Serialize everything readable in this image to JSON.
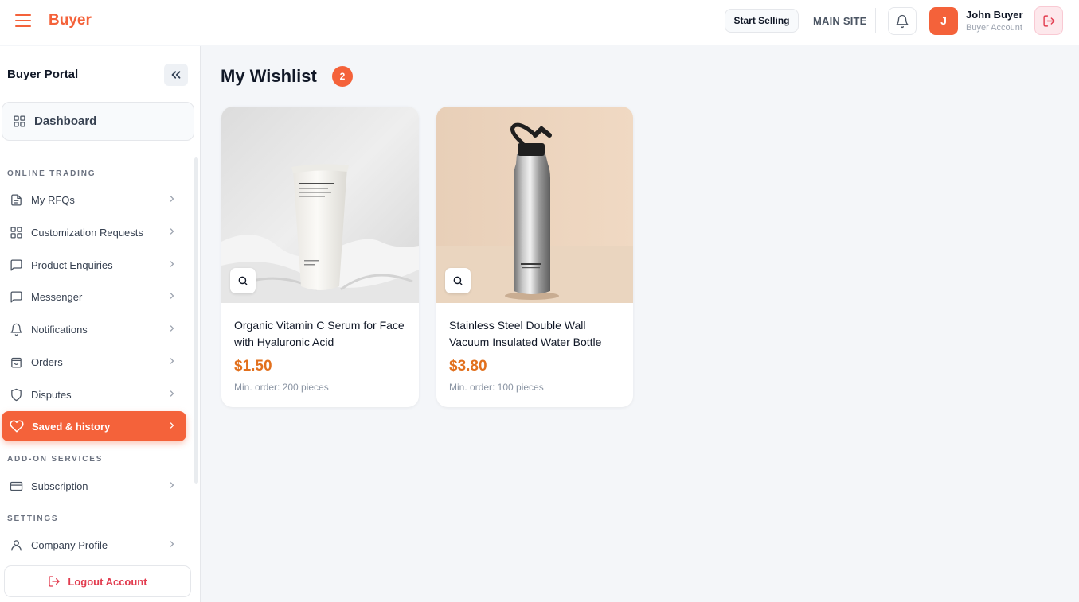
{
  "header": {
    "brand": "Buyer",
    "start_selling": "Start Selling",
    "main_site": "MAIN SITE",
    "user": {
      "initial": "J",
      "name": "John Buyer",
      "role": "Buyer Account"
    }
  },
  "sidebar": {
    "title": "Buyer Portal",
    "dashboard": "Dashboard",
    "sections": {
      "online_trading": "ONLINE TRADING",
      "addon_services": "ADD-ON SERVICES",
      "settings": "SETTINGS"
    },
    "items": [
      {
        "label": "My RFQs",
        "icon": "document-icon"
      },
      {
        "label": "Customization Requests",
        "icon": "grid-icon"
      },
      {
        "label": "Product Enquiries",
        "icon": "chat-icon"
      },
      {
        "label": "Messenger",
        "icon": "chat-icon"
      },
      {
        "label": "Notifications",
        "icon": "bell-icon"
      },
      {
        "label": "Orders",
        "icon": "bag-icon"
      },
      {
        "label": "Disputes",
        "icon": "shield-icon"
      },
      {
        "label": "Saved & history",
        "icon": "heart-icon",
        "active": true
      },
      {
        "label": "Subscription",
        "icon": "card-icon"
      },
      {
        "label": "Company Profile",
        "icon": "user-icon"
      }
    ],
    "logout": "Logout Account"
  },
  "main": {
    "title": "My Wishlist",
    "count": "2",
    "products": [
      {
        "name": "Organic Vitamin C Serum for Face with Hyaluronic Acid",
        "price": "$1.50",
        "moq": "Min. order: 200 pieces"
      },
      {
        "name": "Stainless Steel Double Wall Vacuum Insulated Water Bottle",
        "price": "$3.80",
        "moq": "Min. order: 100 pieces"
      }
    ]
  },
  "colors": {
    "accent": "#f4623a",
    "price": "#e2701d",
    "danger": "#e23c4f"
  }
}
